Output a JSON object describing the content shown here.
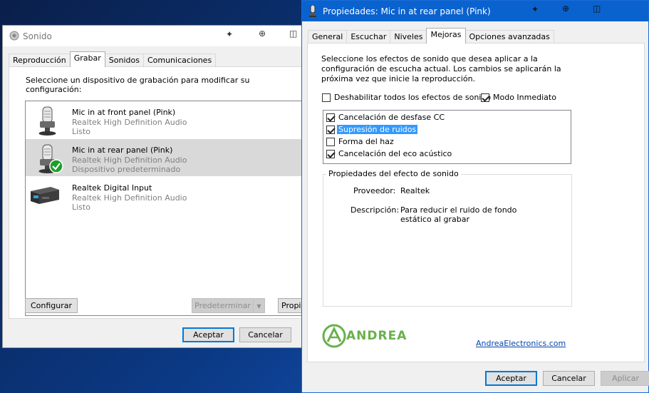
{
  "sonido": {
    "title": "Sonido",
    "tabs": [
      "Reproducción",
      "Grabar",
      "Sonidos",
      "Comunicaciones"
    ],
    "selected_tab": "Grabar",
    "instruction": "Seleccione un dispositivo de grabación para modificar su configuración:",
    "devices": [
      {
        "name": "Mic in at front panel (Pink)",
        "driver": "Realtek High Definition Audio",
        "status": "Listo",
        "icon": "microphone-icon",
        "selected": false,
        "default": false
      },
      {
        "name": "Mic in at rear panel (Pink)",
        "driver": "Realtek High Definition Audio",
        "status": "Dispositivo predeterminado",
        "icon": "microphone-icon",
        "selected": true,
        "default": true
      },
      {
        "name": "Realtek Digital Input",
        "driver": "Realtek High Definition Audio",
        "status": "Listo",
        "icon": "digital-input-icon",
        "selected": false,
        "default": false
      }
    ],
    "buttons": {
      "configure": "Configurar",
      "set_default": "Predeterminar",
      "properties": "Propi",
      "accept": "Aceptar",
      "cancel": "Cancelar"
    }
  },
  "props": {
    "title": "Propiedades: Mic in at rear panel (Pink)",
    "tabs": [
      "General",
      "Escuchar",
      "Niveles",
      "Mejoras",
      "Opciones avanzadas"
    ],
    "selected_tab": "Mejoras",
    "instruction": "Seleccione los efectos de sonido que desea aplicar a la configuración de escucha actual. Los cambios se aplicarán la próxima vez que inicie la reproducción.",
    "disable_all": {
      "label": "Deshabilitar todos los efectos de sonido",
      "checked": false
    },
    "immediate": {
      "label": "Modo Inmediato",
      "checked": true
    },
    "effects": [
      {
        "label": "Cancelación de desfase  CC",
        "checked": true,
        "highlighted": false
      },
      {
        "label": "Supresión de ruidos",
        "checked": true,
        "highlighted": true
      },
      {
        "label": "Forma del haz",
        "checked": false,
        "highlighted": false
      },
      {
        "label": "Cancelación del eco acústico",
        "checked": true,
        "highlighted": false
      }
    ],
    "group_title": "Propiedades del efecto de sonido",
    "provider_label": "Proveedor:",
    "provider_value": "Realtek",
    "description_label": "Descripción:",
    "description_value": "Para reducir el ruido de fondo estático al grabar",
    "logo_text": "ANDREA",
    "link": "AndreaElectronics.com",
    "buttons": {
      "accept": "Aceptar",
      "cancel": "Cancelar",
      "apply": "Aplicar"
    }
  },
  "colors": {
    "titlebar_active": "#0a62cf",
    "highlight": "#3399ff",
    "logo_green": "#6ab04c",
    "check_badge": "#1a9f29"
  }
}
